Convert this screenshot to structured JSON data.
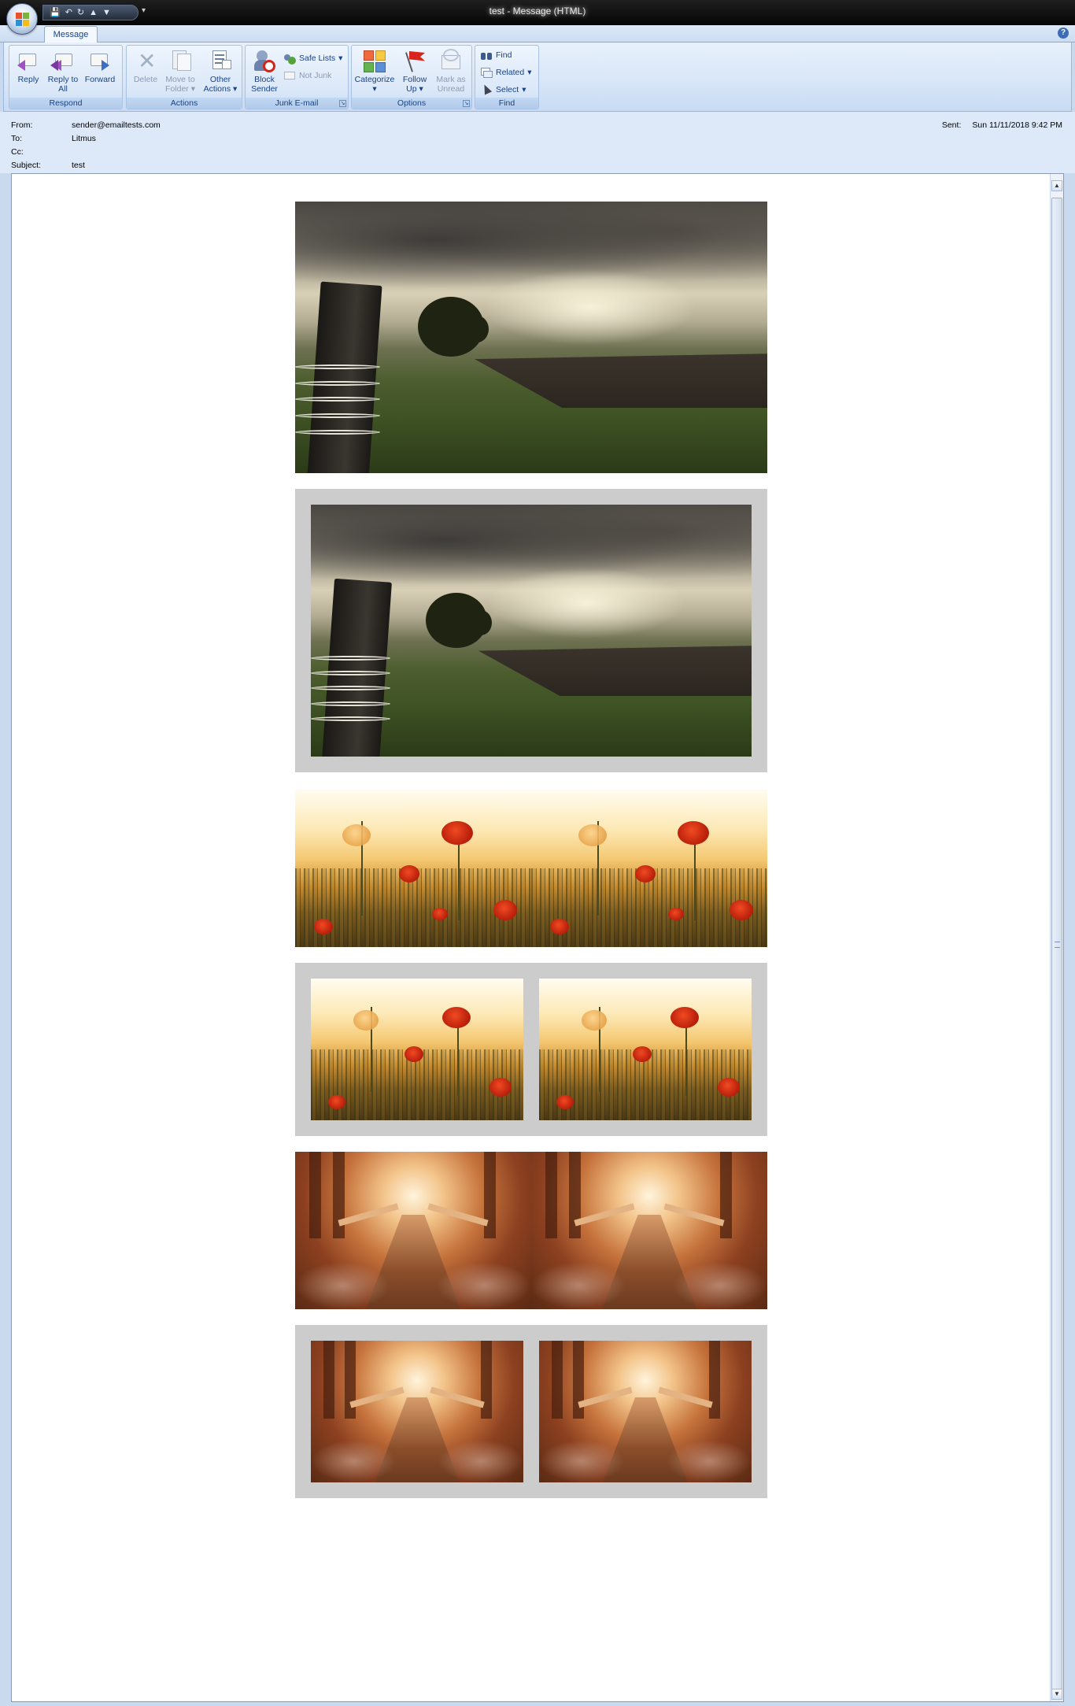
{
  "window": {
    "title": "test - Message (HTML)"
  },
  "ribbon": {
    "tab": "Message",
    "groups": {
      "respond": {
        "label": "Respond",
        "reply": "Reply",
        "reply_all": "Reply to All",
        "forward": "Forward"
      },
      "actions": {
        "label": "Actions",
        "delete": "Delete",
        "move_to_folder": "Move to Folder",
        "other_actions": "Other Actions"
      },
      "junk": {
        "label": "Junk E-mail",
        "block_sender": "Block Sender",
        "safe_lists": "Safe Lists",
        "not_junk": "Not Junk"
      },
      "options": {
        "label": "Options",
        "categorize": "Categorize",
        "follow_up": "Follow Up",
        "mark_as_unread": "Mark as Unread"
      },
      "find": {
        "label": "Find",
        "find": "Find",
        "related": "Related",
        "select": "Select"
      }
    }
  },
  "header": {
    "from_label": "From:",
    "from": "sender@emailtests.com",
    "to_label": "To:",
    "to": "Litmus",
    "cc_label": "Cc:",
    "cc": "",
    "subject_label": "Subject:",
    "subject": "test",
    "sent_label": "Sent:",
    "sent": "Sun 11/11/2018 9:42 PM"
  },
  "colors": {
    "frame": "#cccccc",
    "ribbon_text": "#15428b"
  },
  "body_images": [
    "landscape",
    "landscape-framed",
    "poppy",
    "poppy",
    "poppy-framed",
    "poppy-framed",
    "bridge",
    "bridge",
    "bridge-framed",
    "bridge-framed"
  ]
}
